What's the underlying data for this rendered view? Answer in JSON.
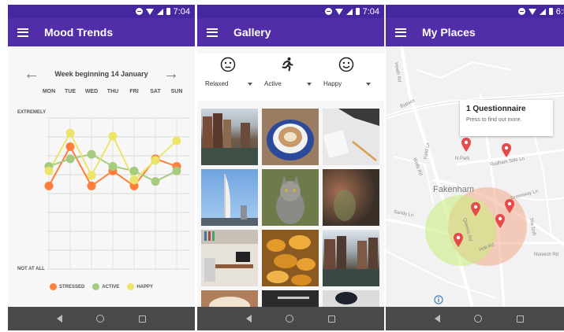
{
  "status": {
    "time1": "7:04",
    "time2": "7:04",
    "time3": "6:5"
  },
  "screens": {
    "mood": {
      "title": "Mood Trends",
      "week_label": "Week beginning 14 January",
      "days": [
        "MON",
        "TUE",
        "WED",
        "THU",
        "FRI",
        "SAT",
        "SUN"
      ],
      "y_top_label": "EXTREMELY",
      "y_bottom_label": "NOT AT ALL"
    },
    "gallery": {
      "title": "Gallery",
      "filters": [
        {
          "icon": "neutral-face-icon",
          "value": "Relaxed"
        },
        {
          "icon": "running-person-icon",
          "value": "Active"
        },
        {
          "icon": "smiling-face-icon",
          "value": "Happy"
        }
      ],
      "photos": [
        "canal-houses-photo",
        "latte-art-cup-photo",
        "desk-notebook-pen-photo",
        "spinnaker-tower-photo",
        "tabby-cat-photo",
        "blurred-indoor-photo",
        "office-desk-room-photo",
        "chanterelle-mushrooms-photo",
        "canal-houses-2-photo",
        "latte-cup-2-photo",
        "spoon-bowl-photo",
        "dark-bowl-photo"
      ]
    },
    "places": {
      "title": "My Places",
      "popup_title": "1 Questionnaire",
      "popup_subtitle": "Press to find out more.",
      "map_labels": [
        "Fakenham",
        "N Park",
        "Rudham Stile Ln",
        "Greenway Ln",
        "Norwich Rd",
        "Holt Rd",
        "Wells Rd",
        "Field Ln",
        "Bypass",
        "Queens Rd",
        "The Drift",
        "Sandy Ln",
        "Heath Rd"
      ]
    }
  },
  "chart_data": {
    "type": "line",
    "categories": [
      "MON",
      "TUE",
      "WED",
      "THU",
      "FRI",
      "SAT",
      "SUN"
    ],
    "ylim": [
      0,
      10
    ],
    "grid": true,
    "legend_position": "bottom",
    "series": [
      {
        "name": "STRESSED",
        "color": "#ff7f3a",
        "values": [
          5.5,
          8.1,
          5.5,
          6.5,
          5.5,
          7.3,
          6.8
        ]
      },
      {
        "name": "ACTIVE",
        "color": "#a5cc7e",
        "values": [
          6.8,
          7.3,
          7.6,
          6.8,
          6.5,
          5.8,
          6.5
        ]
      },
      {
        "name": "HAPPY",
        "color": "#ede56a",
        "values": [
          6.5,
          9.0,
          6.2,
          8.8,
          5.9,
          7.2,
          8.5
        ]
      }
    ]
  }
}
